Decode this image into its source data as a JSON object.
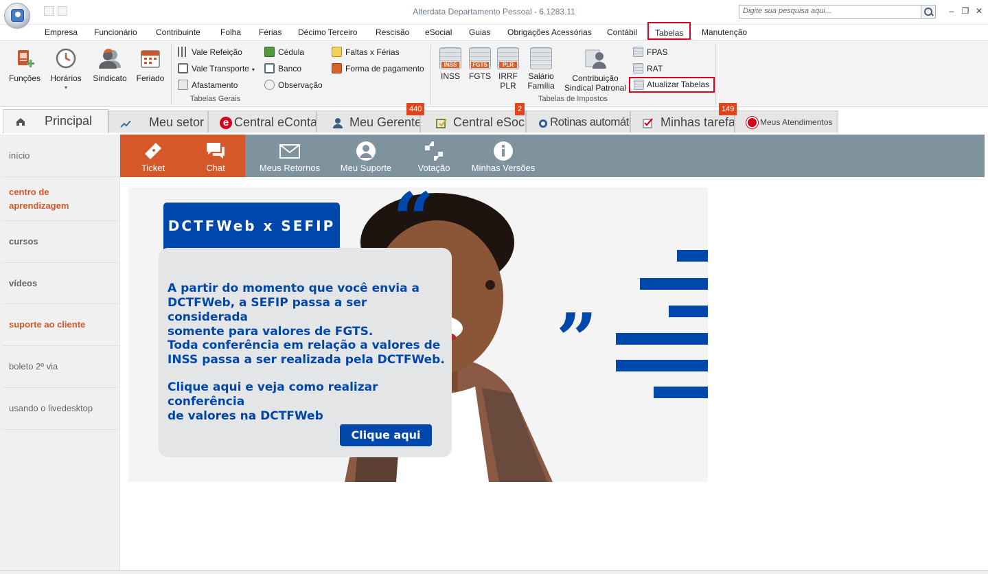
{
  "window": {
    "title": "Alterdata Departamento Pessoal - 6.1283.11",
    "search_placeholder": "Digite sua pesquisa aqui..."
  },
  "menu": {
    "items": [
      "Empresa",
      "Funcionário",
      "Contribuinte",
      "Folha",
      "Férias",
      "Décimo Terceiro",
      "Rescisão",
      "eSocial",
      "Guias",
      "Obrigações Acessórias",
      "Contábil",
      "Tabelas",
      "Manutenção"
    ],
    "active": "Tabelas"
  },
  "ribbon": {
    "group_gerais_label": "Tabelas Gerais",
    "group_impostos_label": "Tabelas de Impostos",
    "funcoes": "Funções",
    "horarios": "Horários",
    "sindicato": "Sindicato",
    "feriado": "Feriado",
    "vale_refeicao": "Vale Refeição",
    "vale_transporte": "Vale Transporte",
    "afastamento": "Afastamento",
    "cedula": "Cédula",
    "banco": "Banco",
    "observacao": "Observação",
    "faltas_ferias": "Faltas x Férias",
    "forma_pagamento": "Forma de pagamento",
    "inss": "INSS",
    "inss_icon_text": "INSS",
    "fgts": "FGTS",
    "fgts_icon_text": "FGTS",
    "irrf_line1": "IRRF",
    "irrf_line2": "PLR",
    "plr_icon_text": "PLR",
    "salario_line1": "Salário",
    "salario_line2": "Família",
    "contrib_line1": "Contribuição",
    "contrib_line2": "Sindical Patronal",
    "fpas": "FPAS",
    "rat": "RAT",
    "atualizar_tabelas": "Atualizar Tabelas"
  },
  "tabs": {
    "principal": "Principal",
    "meu_setor": "Meu setor",
    "central_econtador": "Central eContador",
    "meu_gerente": "Meu Gerente",
    "central_esocial": "Central eSocial",
    "rotinas": "Rotinas automáticas",
    "minhas_tarefas": "Minhas tarefas",
    "meus_atendimentos": "Meus Atendimentos",
    "badge_gerente": "440",
    "badge_esocial": "2",
    "badge_tarefas": "149"
  },
  "leftnav": {
    "inicio": "início",
    "centro_line1": "centro de",
    "centro_line2": "aprendizagem",
    "cursos": "cursos",
    "videos": "vídeos",
    "suporte": "suporte ao cliente",
    "boleto": "boleto 2º via",
    "livedesktop": "usando o livedesktop"
  },
  "iconbar": {
    "ticket": "Ticket",
    "chat": "Chat",
    "meus_retornos": "Meus Retornos",
    "meu_suporte": "Meu Suporte",
    "votacao": "Votação",
    "minhas_versoes": "Minhas Versões"
  },
  "banner": {
    "title": "DCTFWeb x SEFIP",
    "para1_l1": "A partir do momento que você envia a",
    "para1_l2": "DCTFWeb, a SEFIP passa a ser considerada",
    "para1_l3": "somente para valores de FGTS.",
    "para2_l1": "Toda conferência em relação a valores de",
    "para2_l2": "INSS passa a ser realizada pela DCTFWeb.",
    "para3_l1": "Clique aqui e veja como realizar conferência",
    "para3_l2": "de valores na DCTFWeb",
    "button": "Clique aqui"
  },
  "colors": {
    "accent_orange": "#d4582a",
    "banner_blue": "#0047ab",
    "iconbar_gray": "#7f939f",
    "highlight_red": "#e0001b"
  }
}
